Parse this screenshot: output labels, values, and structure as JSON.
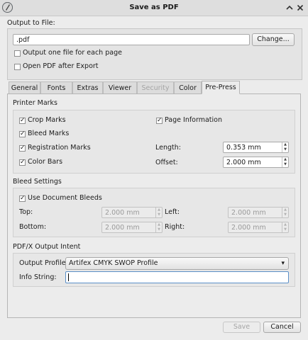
{
  "window": {
    "title": "Save as PDF"
  },
  "output": {
    "group_label": "Output to File:",
    "file_value": ".pdf",
    "change_button": "Change...",
    "one_file_per_page": {
      "label": "Output one file for each page",
      "checked": false
    },
    "open_after_export": {
      "label": "Open PDF after Export",
      "checked": false
    }
  },
  "tabs": [
    {
      "label": "General",
      "active": false,
      "enabled": true
    },
    {
      "label": "Fonts",
      "active": false,
      "enabled": true
    },
    {
      "label": "Extras",
      "active": false,
      "enabled": true
    },
    {
      "label": "Viewer",
      "active": false,
      "enabled": true
    },
    {
      "label": "Security",
      "active": false,
      "enabled": false
    },
    {
      "label": "Color",
      "active": false,
      "enabled": true
    },
    {
      "label": "Pre-Press",
      "active": true,
      "enabled": true
    }
  ],
  "printer_marks": {
    "title": "Printer Marks",
    "crop_marks": {
      "label": "Crop Marks",
      "checked": true
    },
    "bleed_marks": {
      "label": "Bleed Marks",
      "checked": true
    },
    "registration_marks": {
      "label": "Registration Marks",
      "checked": true
    },
    "color_bars": {
      "label": "Color Bars",
      "checked": true
    },
    "page_information": {
      "label": "Page Information",
      "checked": true
    },
    "length_label": "Length:",
    "length_value": "0.353 mm",
    "offset_label": "Offset:",
    "offset_value": "2.000 mm"
  },
  "bleed_settings": {
    "title": "Bleed Settings",
    "use_document_bleeds": {
      "label": "Use Document Bleeds",
      "checked": true
    },
    "top_label": "Top:",
    "top_value": "2.000 mm",
    "bottom_label": "Bottom:",
    "bottom_value": "2.000 mm",
    "left_label": "Left:",
    "left_value": "2.000 mm",
    "right_label": "Right:",
    "right_value": "2.000 mm"
  },
  "pdfx": {
    "title": "PDF/X Output Intent",
    "output_profile_label": "Output Profile:",
    "output_profile_value": "Artifex CMYK SWOP Profile",
    "info_string_label": "Info String:",
    "info_string_value": ""
  },
  "footer": {
    "save_button": "Save",
    "cancel_button": "Cancel"
  },
  "check_glyph": "✓",
  "spin_up": "▲",
  "spin_down": "▼",
  "dropdown_arrow": "▾"
}
